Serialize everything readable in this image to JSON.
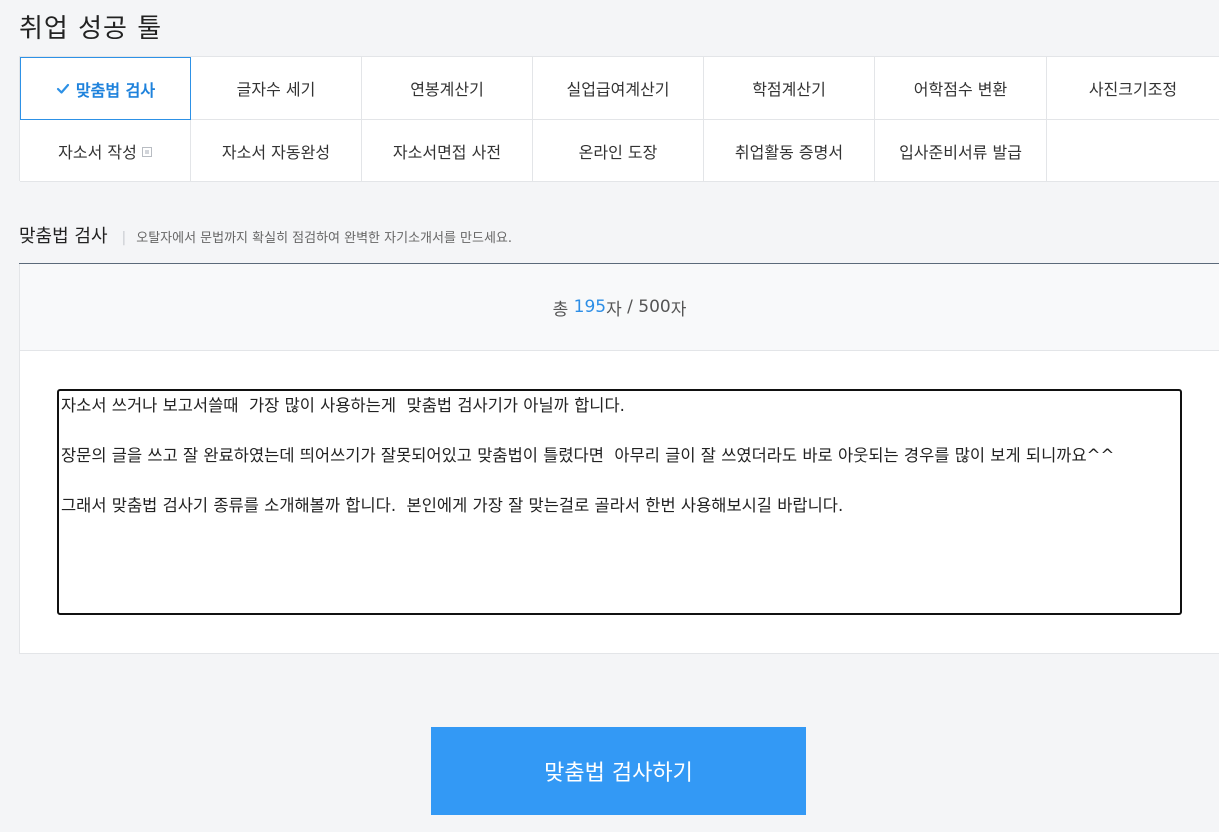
{
  "header": {
    "title": "취업 성공 툴"
  },
  "tools": {
    "row1": [
      {
        "label": "맞춤법 검사",
        "active": true
      },
      {
        "label": "글자수 세기"
      },
      {
        "label": "연봉계산기"
      },
      {
        "label": "실업급여계산기"
      },
      {
        "label": "학점계산기"
      },
      {
        "label": "어학점수 변환"
      },
      {
        "label": "사진크기조정"
      }
    ],
    "row2": [
      {
        "label": "자소서 작성",
        "external": true
      },
      {
        "label": "자소서 자동완성"
      },
      {
        "label": "자소서면접 사전"
      },
      {
        "label": "온라인 도장"
      },
      {
        "label": "취업활동 증명서"
      },
      {
        "label": "입사준비서류 발급"
      },
      {
        "label": ""
      }
    ]
  },
  "section": {
    "title": "맞춤법 검사",
    "description": "오탈자에서 문법까지 확실히 점검하여 완벽한 자기소개서를 만드세요."
  },
  "counter": {
    "prefix": "총 ",
    "current": "195",
    "unit_after_current": "자",
    "separator": " / ",
    "max": "500",
    "unit_after_max": "자"
  },
  "editor": {
    "text": "자소서 쓰거나 보고서쓸때  가장 많이 사용하는게  맞춤법 검사기가 아닐까 합니다.\n\n장문의 글을 쓰고 잘 완료하였는데 띄어쓰기가 잘못되어있고 맞춤법이 틀렸다면  아무리 글이 잘 쓰였더라도 바로 아웃되는 경우를 많이 보게 되니까요^^\n\n그래서 맞춤법 검사기 종류를 소개해볼까 합니다.  본인에게 가장 잘 맞는걸로 골라서 한번 사용해보시길 바랍니다."
  },
  "action": {
    "submit_label": "맞춤법 검사하기"
  },
  "colors": {
    "accent": "#2d91e6",
    "button": "#3399f5",
    "background": "#f4f5f7"
  }
}
